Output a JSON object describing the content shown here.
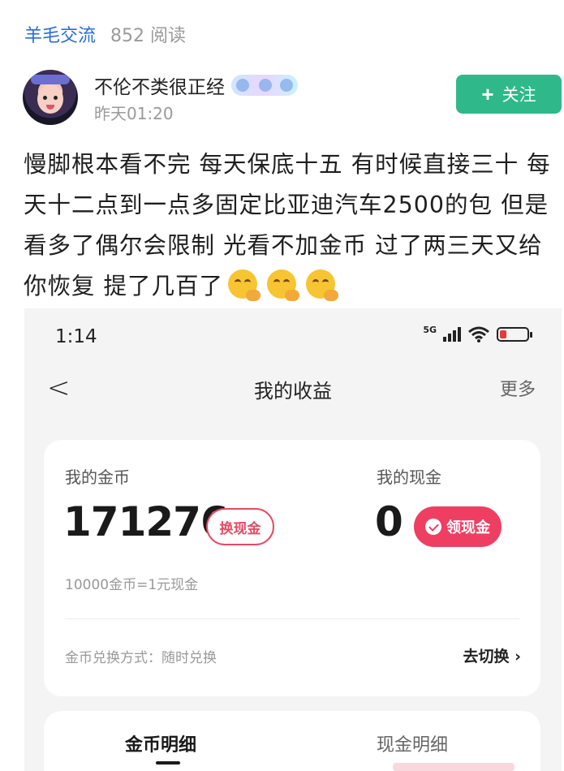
{
  "header": {
    "forum": "羊毛交流",
    "reads": "852 阅读"
  },
  "author": {
    "name": "不伦不类很正经",
    "time": "昨天01:20",
    "follow_label": "关注",
    "follow_icon": "plus-icon"
  },
  "post": {
    "text": "慢脚根本看不完  每天保底十五  有时候直接三十  每天十二点到一点多固定比亚迪汽车2500的包  但是看多了偶尔会限制  光看不加金币  过了两三天又给你恢复  提了几百了",
    "emoji_count": 3,
    "emoji_icon": "yawning-face-icon"
  },
  "screenshot": {
    "status": {
      "time": "1:14",
      "network": "5G"
    },
    "nav": {
      "back_icon": "chevron-left-icon",
      "title": "我的收益",
      "more": "更多"
    },
    "card": {
      "coin_label": "我的金币",
      "coin_value": "171276",
      "exchange_label": "换现金",
      "cash_label": "我的现金",
      "cash_value": "0",
      "withdraw_label": "领现金",
      "rate_text": "10000金币=1元现金",
      "method_text": "金币兑换方式：随时兑换",
      "switch_label": "去切换 ›"
    },
    "tabs": [
      {
        "label": "金币明细"
      },
      {
        "label": "现金明细"
      }
    ]
  },
  "colors": {
    "link_blue": "#2c6bd8",
    "follow_green": "#2fb98a",
    "accent_red": "#ee3f63"
  }
}
